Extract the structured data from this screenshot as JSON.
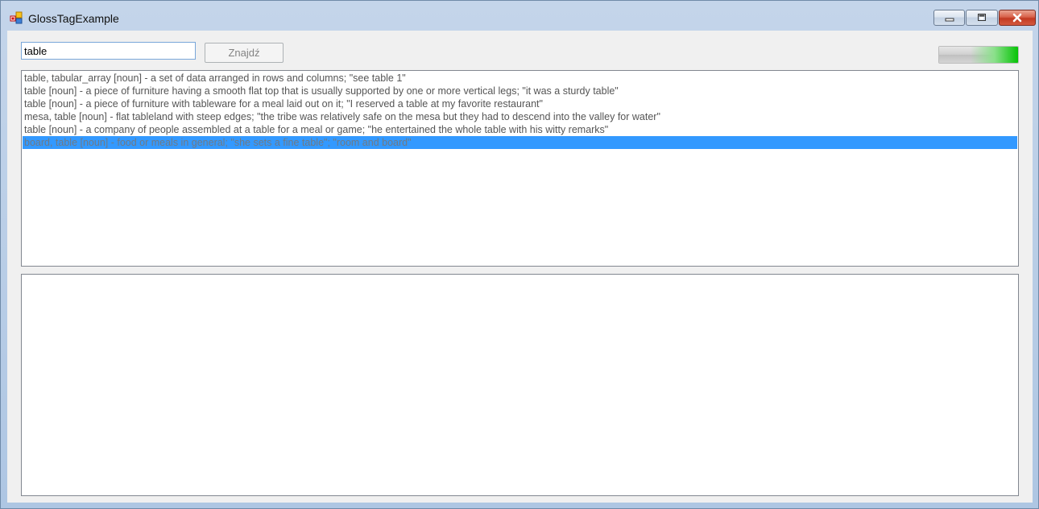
{
  "window": {
    "title": "GlossTagExample",
    "icon": "app-icon"
  },
  "search": {
    "value": "table",
    "button_label": "Znajdź"
  },
  "progress": {
    "fraction": 1.0
  },
  "results": [
    "table, tabular_array [noun] -  a set of data arranged in rows and columns; \"see table 1\"",
    "table [noun] -  a piece of furniture having a smooth flat top that is usually supported by one or more vertical legs; \"it was a sturdy table\"",
    "table [noun] -  a piece of furniture with tableware for a meal laid out on it; \"I reserved a table at my favorite restaurant\"",
    "mesa, table [noun] -  flat tableland with steep edges; \"the tribe was relatively safe on the mesa but they had to descend into the valley for water\"",
    "table [noun] -  a company of people assembled at a table for a meal or game; \"he entertained the whole table with his witty remarks\"",
    "board, table [noun] -  food or meals in general; \"she sets a fine table\"; \"room and board\""
  ],
  "selected_index": 5,
  "colors": {
    "selection": "#3399ff",
    "progress_green": "#06c406"
  }
}
